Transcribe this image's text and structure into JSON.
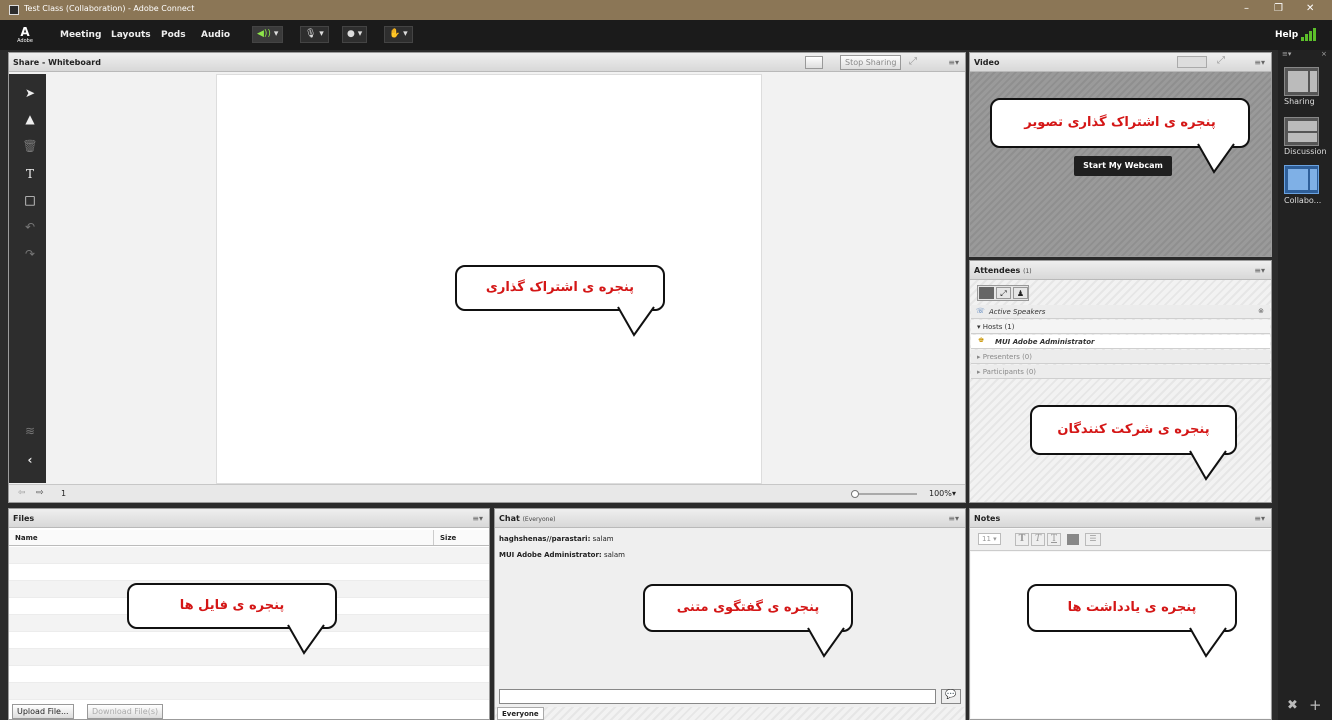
{
  "window": {
    "title": "Test Class (Collaboration) - Adobe Connect",
    "minimize": "–",
    "restore": "❐",
    "close": "✕"
  },
  "menubar": {
    "logo": "A",
    "logo_sub": "Adobe",
    "menus": [
      "Meeting",
      "Layouts",
      "Pods",
      "Audio"
    ],
    "help": "Help"
  },
  "share_pod": {
    "title": "Share - Whiteboard",
    "stop_sharing": "Stop Sharing",
    "page_number": "1",
    "zoom": "100%",
    "bubble": "پنجره ی اشتراک گذاری"
  },
  "video_pod": {
    "title": "Video",
    "start_webcam": "Start My Webcam",
    "bubble": "پنجره ی اشتراک گذاری تصویر"
  },
  "attendees_pod": {
    "title": "Attendees",
    "count": "(1)",
    "active_speakers": "Active Speakers",
    "hosts": "Hosts (1)",
    "host_user": "MUI Adobe Administrator",
    "presenters": "Presenters (0)",
    "participants": "Participants (0)",
    "bubble": "پنجره ی شرکت کنندگان"
  },
  "files_pod": {
    "title": "Files",
    "col_name": "Name",
    "col_size": "Size",
    "upload": "Upload File...",
    "download": "Download File(s)",
    "bubble": "پنجره ی فایل ها"
  },
  "chat_pod": {
    "title": "Chat",
    "scope": "(Everyone)",
    "messages": [
      {
        "sender": "haghshenas//parastari:",
        "text": "salam"
      },
      {
        "sender": "MUI Adobe Administrator:",
        "text": "salam"
      }
    ],
    "tab": "Everyone",
    "bubble": "پنجره ی گفتگوی متنی"
  },
  "notes_pod": {
    "title": "Notes",
    "font_size": "11",
    "bubble": "پنجره ی یادداشت ها"
  },
  "layouts": [
    {
      "label": "Sharing"
    },
    {
      "label": "Discussion"
    },
    {
      "label": "Collabo..."
    }
  ],
  "colors": {
    "title_bar": "#8b7656",
    "bubble_text": "#d41616",
    "audio_green": "#8ee64a"
  }
}
